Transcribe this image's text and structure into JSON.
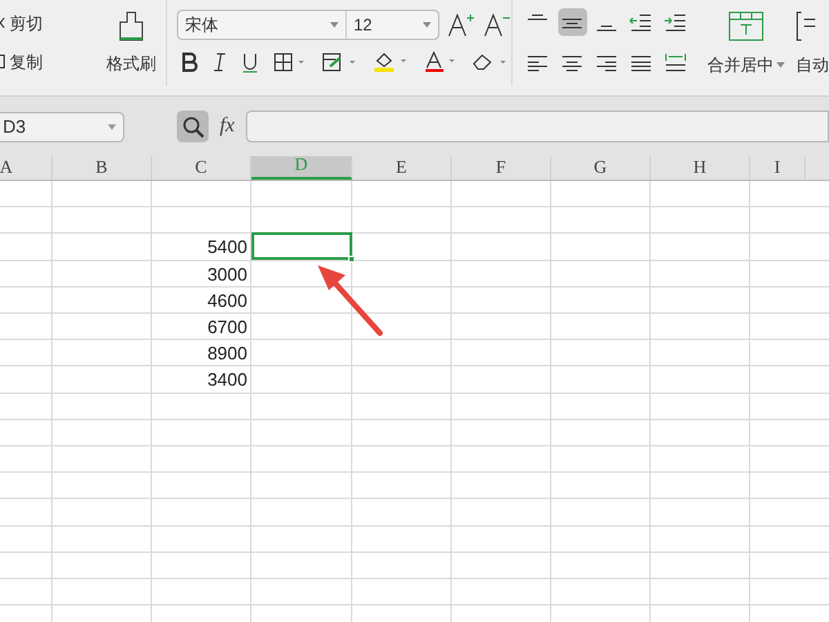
{
  "toolbar": {
    "cut": "剪切",
    "copy": "复制",
    "format_painter": "格式刷",
    "font_name": "宋体",
    "font_size": "12",
    "merge_center": "合并居中",
    "auto_wrap": "自动",
    "align_buttons": [
      {
        "kind": "top",
        "selected": false
      },
      {
        "kind": "middle",
        "selected": true
      },
      {
        "kind": "bottom",
        "selected": false
      },
      {
        "kind": "outdent",
        "selected": false
      },
      {
        "kind": "indent",
        "selected": false
      }
    ]
  },
  "formula_bar": {
    "name_box": "D3",
    "fx": "fx"
  },
  "columns": [
    {
      "label": "A",
      "selected": false
    },
    {
      "label": "B",
      "selected": false
    },
    {
      "label": "C",
      "selected": false
    },
    {
      "label": "D",
      "selected": true
    },
    {
      "label": "E",
      "selected": false
    },
    {
      "label": "F",
      "selected": false
    },
    {
      "label": "G",
      "selected": false
    },
    {
      "label": "H",
      "selected": false
    },
    {
      "label": "I",
      "selected": false
    }
  ],
  "rows": [
    {
      "column_c": "5400",
      "selected": true
    },
    {
      "column_c": "3000",
      "selected": false
    },
    {
      "column_c": "4600",
      "selected": false
    },
    {
      "column_c": "6700",
      "selected": false
    },
    {
      "column_c": "8900",
      "selected": false
    },
    {
      "column_c": "3400",
      "selected": false
    }
  ]
}
